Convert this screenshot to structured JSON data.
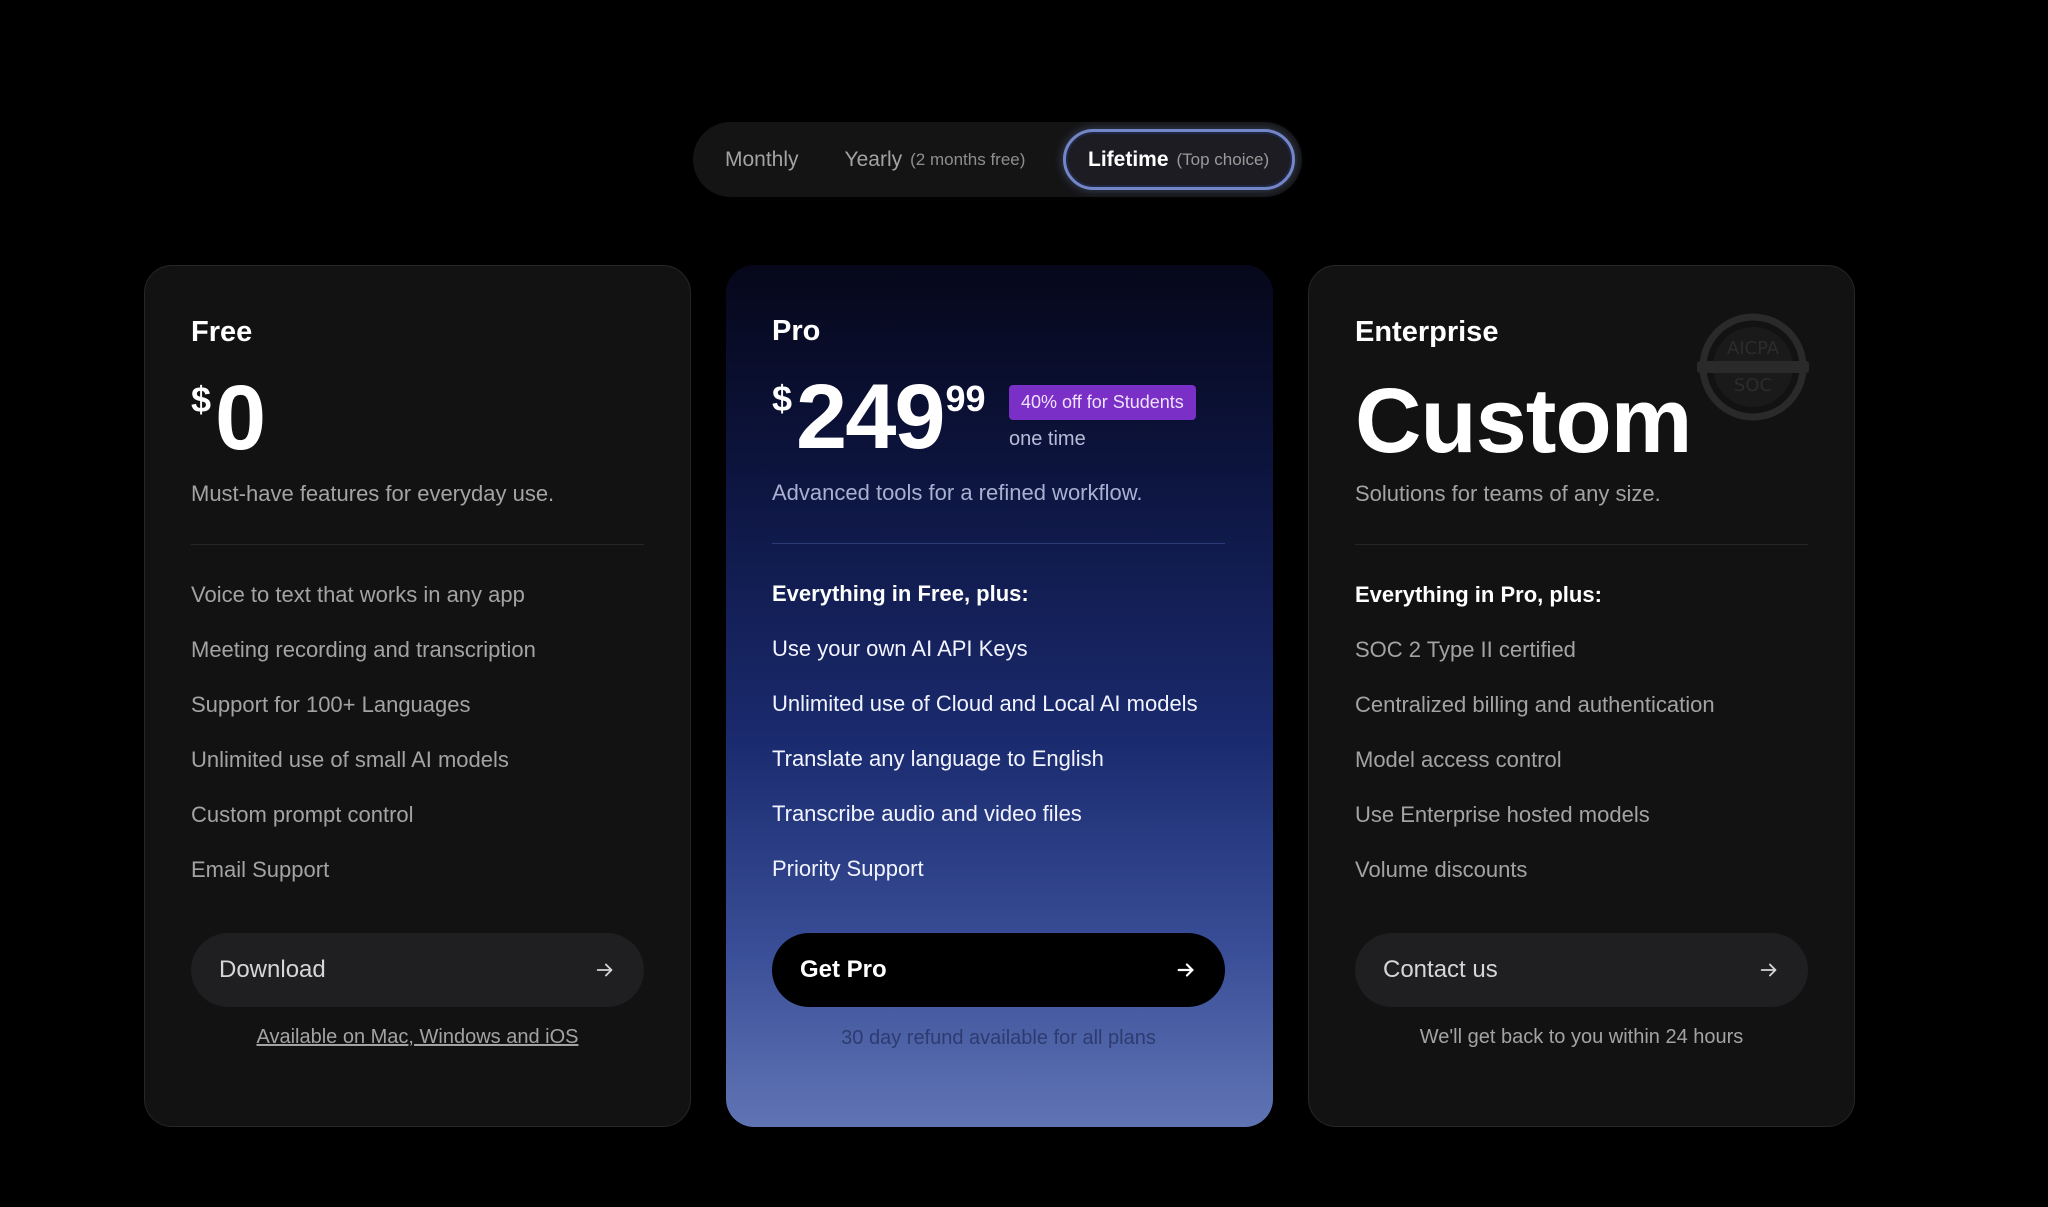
{
  "billing_toggle": {
    "monthly": {
      "label": "Monthly"
    },
    "yearly": {
      "label": "Yearly",
      "note": "(2 months free)"
    },
    "lifetime": {
      "label": "Lifetime",
      "note": "(Top choice)",
      "selected": true
    }
  },
  "plans": {
    "free": {
      "name": "Free",
      "currency": "$",
      "price": "0",
      "tagline": "Must-have features for everyday use.",
      "features": [
        "Voice to text that works in any app",
        "Meeting recording and transcription",
        "Support for 100+ Languages",
        "Unlimited use of small AI models",
        "Custom prompt control",
        "Email Support"
      ],
      "cta_label": "Download",
      "cta_note": "Available on Mac, Windows and iOS"
    },
    "pro": {
      "name": "Pro",
      "currency": "$",
      "price": "249",
      "cents": "99",
      "badge": "40% off for Students",
      "billing_period": "one time",
      "tagline": "Advanced tools for a refined workflow.",
      "features_heading": "Everything in Free, plus:",
      "features": [
        "Use your own AI API Keys",
        "Unlimited use of Cloud and Local AI models",
        "Translate any language to English",
        "Transcribe audio and video files",
        "Priority Support"
      ],
      "cta_label": "Get Pro",
      "cta_note": "30 day refund available for all plans"
    },
    "enterprise": {
      "name": "Enterprise",
      "price": "Custom",
      "soc_badge": {
        "top": "AICPA",
        "bottom": "SOC"
      },
      "tagline": "Solutions for teams of any size.",
      "features_heading": "Everything in Pro, plus:",
      "features": [
        "SOC 2 Type II certified",
        "Centralized billing and authentication",
        "Model access control",
        "Use Enterprise hosted models",
        "Volume discounts"
      ],
      "cta_label": "Contact us",
      "cta_note": "We'll get back to you within 24 hours"
    }
  },
  "colors": {
    "background": "#000000",
    "card": "#121212",
    "student_badge": "#7a2fc7",
    "pro_gradient_top": "#06071a",
    "pro_gradient_bottom": "#6074b4",
    "toggle_selected_border": "#7387c8"
  },
  "icons": {
    "cta_arrow": "arrow-right-icon",
    "enterprise_badge": "aicpa-soc-badge"
  }
}
